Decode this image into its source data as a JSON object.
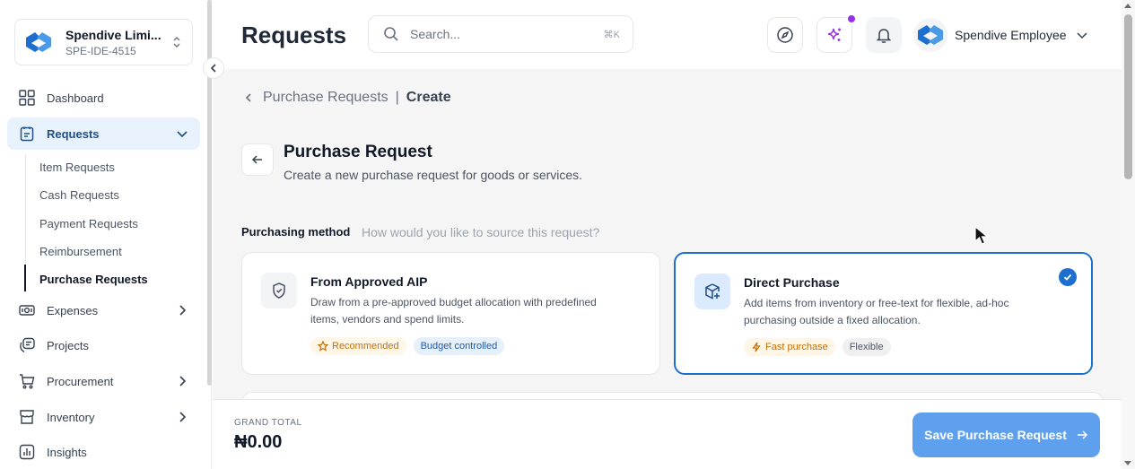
{
  "org": {
    "name": "Spendive Limi...",
    "id": "SPE-IDE-4515"
  },
  "sidebar": {
    "items": [
      {
        "label": "Dashboard"
      },
      {
        "label": "Requests"
      },
      {
        "label": "Expenses"
      },
      {
        "label": "Projects"
      },
      {
        "label": "Procurement"
      },
      {
        "label": "Inventory"
      },
      {
        "label": "Insights"
      }
    ],
    "sub_items": [
      {
        "label": "Item Requests"
      },
      {
        "label": "Cash Requests"
      },
      {
        "label": "Payment Requests"
      },
      {
        "label": "Reimbursement"
      },
      {
        "label": "Purchase Requests"
      }
    ]
  },
  "header": {
    "title": "Requests",
    "search_placeholder": "Search...",
    "search_shortcut": "⌘K",
    "user_name": "Spendive Employee"
  },
  "breadcrumb": {
    "parent": "Purchase Requests",
    "separator": "|",
    "current": "Create"
  },
  "form": {
    "title": "Purchase Request",
    "subtitle": "Create a new purchase request for goods or services.",
    "method_label": "Purchasing method",
    "method_hint": "How would you like to source this request?"
  },
  "methods": [
    {
      "title": "From Approved AIP",
      "description": "Draw from a pre-approved budget allocation with predefined items, vendors and spend limits.",
      "badges": [
        "Recommended",
        "Budget controlled"
      ],
      "selected": false
    },
    {
      "title": "Direct Purchase",
      "description": "Add items from inventory or free-text for flexible, ad-hoc purchasing outside a fixed allocation.",
      "badges": [
        "Fast purchase",
        "Flexible"
      ],
      "selected": true
    }
  ],
  "footer": {
    "total_label": "GRAND TOTAL",
    "total_value": "₦0.00",
    "save_label": "Save Purchase Request"
  },
  "colors": {
    "primary": "#1d6fcf",
    "save_button": "#5fa0ee",
    "active_nav_bg": "#e8f2fc",
    "ai_dot": "#9333ea"
  }
}
